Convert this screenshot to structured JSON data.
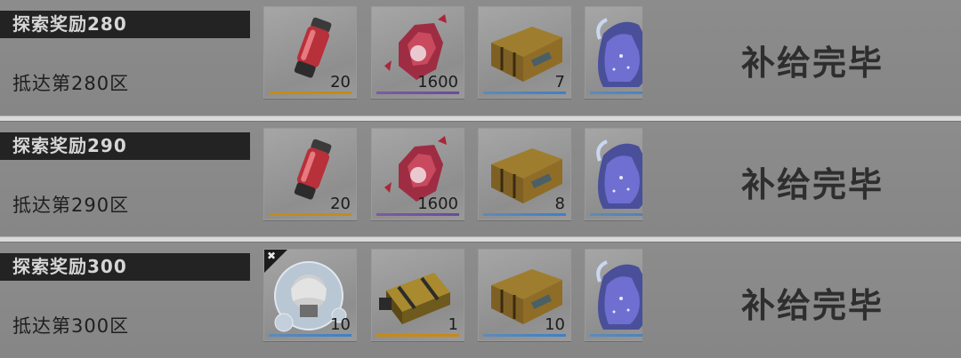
{
  "rows": [
    {
      "title": "探索奖励280",
      "subtitle": "抵达第280区",
      "status": "补给完毕",
      "items": [
        {
          "icon": "red-canister-icon",
          "count": "20",
          "rarity_color": "#c68a17"
        },
        {
          "icon": "red-crystal-icon",
          "count": "1600",
          "rarity_color": "#6a4aa0"
        },
        {
          "icon": "golden-supply-crate-icon",
          "count": "7",
          "rarity_color": "#3f7fc7"
        },
        {
          "icon": "galaxy-potion-bottle-icon",
          "count": "",
          "rarity_color": "#3f7fc7"
        }
      ]
    },
    {
      "title": "探索奖励290",
      "subtitle": "抵达第290区",
      "status": "补给完毕",
      "items": [
        {
          "icon": "red-canister-icon",
          "count": "20",
          "rarity_color": "#c68a17"
        },
        {
          "icon": "red-crystal-icon",
          "count": "1600",
          "rarity_color": "#6a4aa0"
        },
        {
          "icon": "golden-supply-crate-icon",
          "count": "8",
          "rarity_color": "#3f7fc7"
        },
        {
          "icon": "galaxy-potion-bottle-icon",
          "count": "",
          "rarity_color": "#3f7fc7"
        }
      ]
    },
    {
      "title": "探索奖励300",
      "subtitle": "抵达第300区",
      "status": "补给完毕",
      "items": [
        {
          "icon": "character-bubble-icon",
          "count": "10",
          "rarity_color": "#3f7fc7"
        },
        {
          "icon": "golden-capsule-icon",
          "count": "1",
          "rarity_color": "#c68a17"
        },
        {
          "icon": "golden-supply-crate-icon",
          "count": "10",
          "rarity_color": "#3f7fc7"
        },
        {
          "icon": "galaxy-potion-bottle-icon",
          "count": "",
          "rarity_color": "#3f7fc7"
        }
      ]
    }
  ]
}
